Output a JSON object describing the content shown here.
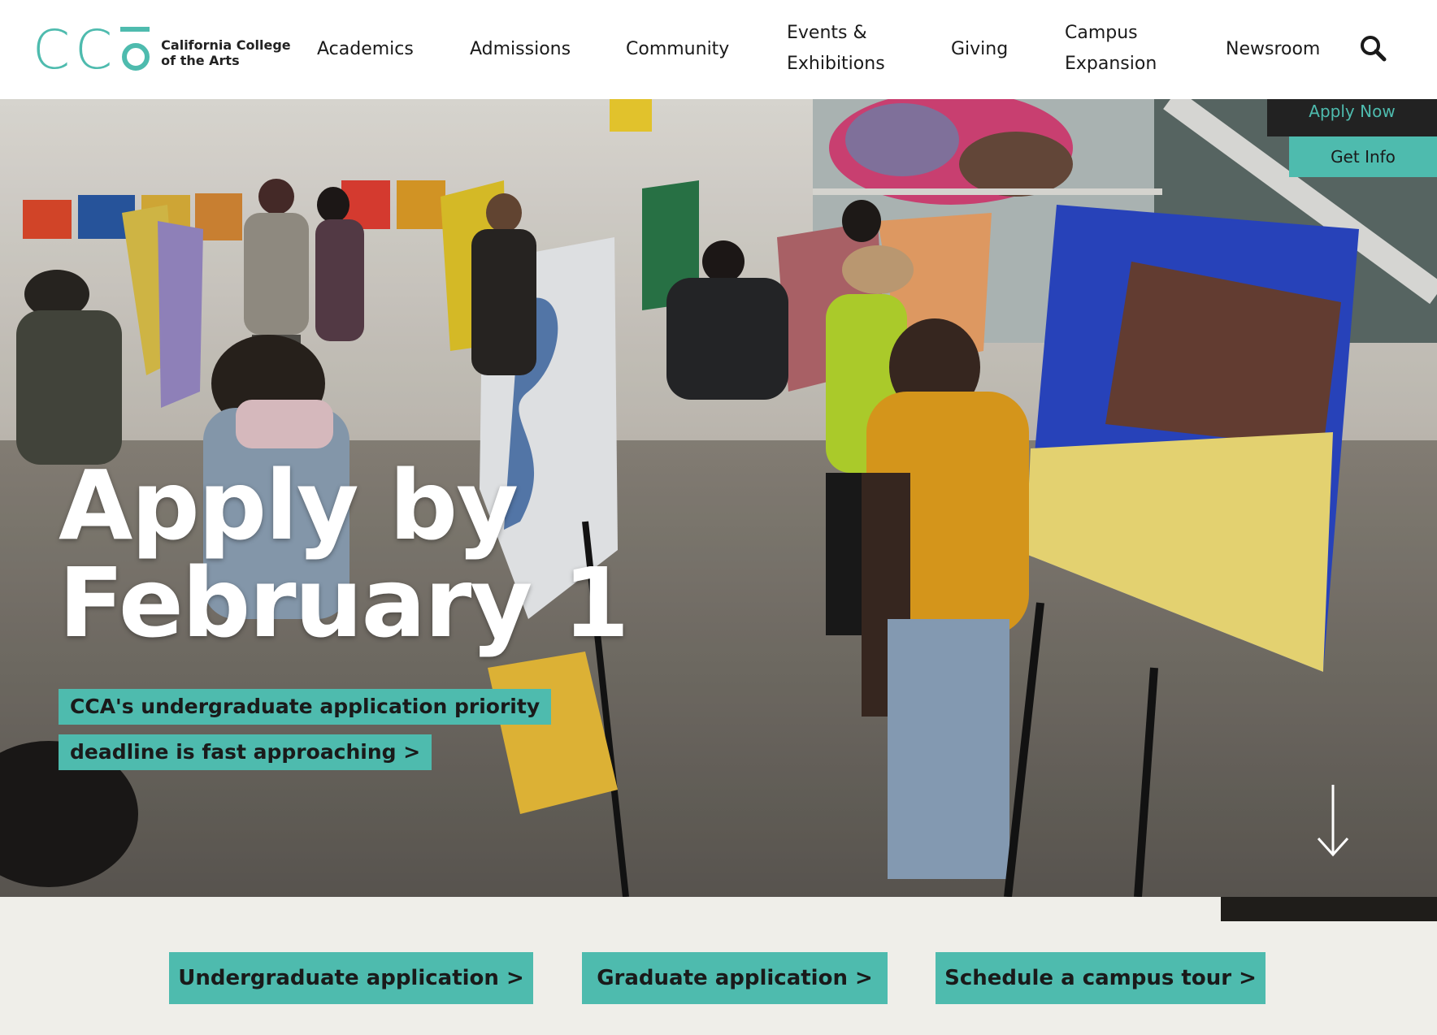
{
  "header": {
    "logo": {
      "mark": "CCa",
      "line1": "California College",
      "line2": "of the Arts"
    },
    "nav": [
      {
        "label": "Academics"
      },
      {
        "label": "Admissions"
      },
      {
        "label": "Community"
      },
      {
        "label_line1": "Events &",
        "label_line2": "Exhibitions"
      },
      {
        "label": "Giving"
      },
      {
        "label_line1": "Campus",
        "label_line2": "Expansion"
      },
      {
        "label": "Newsroom"
      }
    ],
    "search_icon": "search-icon"
  },
  "side_ctas": {
    "apply_now": "Apply Now",
    "get_info": "Get Info"
  },
  "hero": {
    "title_line1": "Apply by",
    "title_line2": "February 1",
    "subtitle_line1": "CCA's undergraduate application priority",
    "subtitle_line2": "deadline is fast approaching >",
    "scroll_icon": "arrow-down-icon"
  },
  "ctas": [
    {
      "label": "Undergraduate application  >"
    },
    {
      "label": "Graduate application  >"
    },
    {
      "label": "Schedule a campus tour  >"
    }
  ],
  "colors": {
    "accent": "#4ebbae",
    "dark": "#222222",
    "band": "#efeee9"
  }
}
